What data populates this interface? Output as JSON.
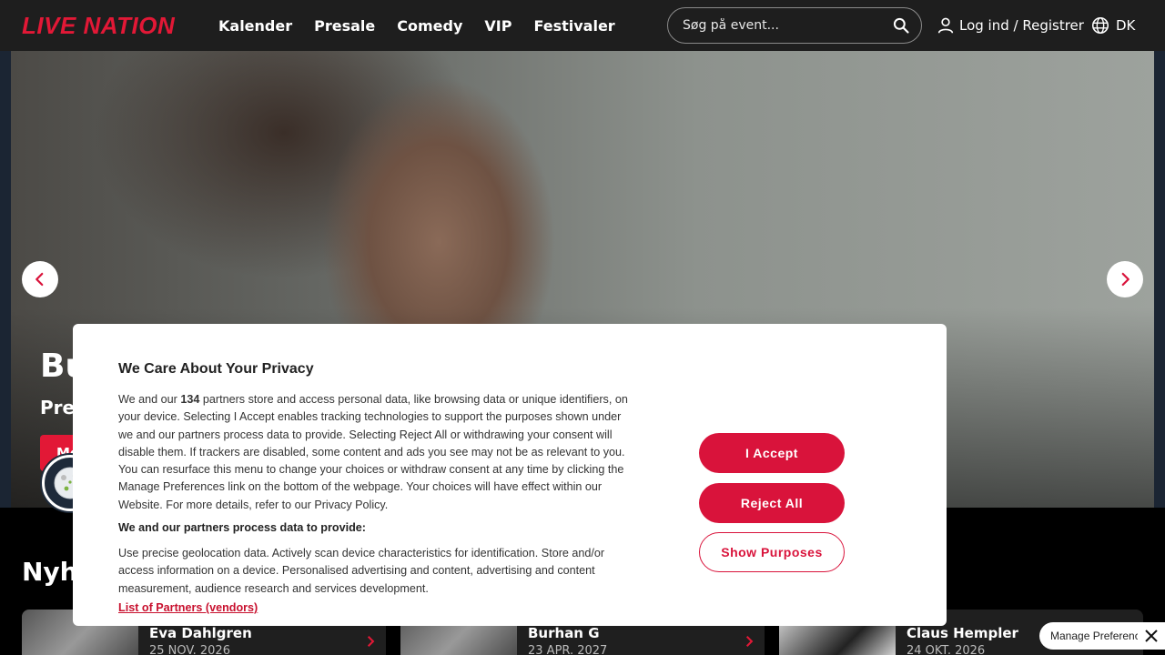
{
  "header": {
    "logo": "LIVE NATION",
    "nav": [
      "Kalender",
      "Presale",
      "Comedy",
      "VIP",
      "Festivaler"
    ],
    "search_placeholder": "Søg på event...",
    "login_label": "Log ind / Registrer",
    "lang_label": "DK"
  },
  "hero": {
    "title": "Bu",
    "subtitle": "Pres",
    "button_label": "Me"
  },
  "news": {
    "title": "Nyhe",
    "cards": [
      {
        "name": "Eva Dahlgren",
        "date": "25 NOV. 2026"
      },
      {
        "name": "Burhan G",
        "date": "23 APR. 2027"
      },
      {
        "name": "Claus Hempler",
        "date": "24 OKT. 2026"
      }
    ]
  },
  "consent": {
    "title": "We Care About Your Privacy",
    "body_pre": "We and our ",
    "partner_count": "134",
    "body_post": " partners store and access personal data, like browsing data or unique identifiers, on your device. Selecting I Accept enables tracking technologies to support the purposes shown under we and our partners process data to provide. Selecting Reject All or withdrawing your consent will disable them. If trackers are disabled, some content and ads you see may not be as relevant to you. You can resurface this menu to change your choices or withdraw consent at any time by clicking the Manage Preferences link on the bottom of the webpage. Your choices will have effect within our Website. For more details, refer to our Privacy Policy.",
    "subheading": "We and our partners process data to provide:",
    "purposes": "Use precise geolocation data. Actively scan device characteristics for identification. Store and/or access information on a device. Personalised advertising and content, advertising and content measurement, audience research and services development.",
    "partners_link": "List of Partners (vendors)",
    "accept_label": "I Accept",
    "reject_label": "Reject All",
    "purposes_label": "Show Purposes"
  },
  "manage_preferences_label": "Manage Preferences",
  "colors": {
    "brand_red": "#e21836",
    "consent_red": "#d9133b",
    "header_bg": "#1e1e1e"
  }
}
